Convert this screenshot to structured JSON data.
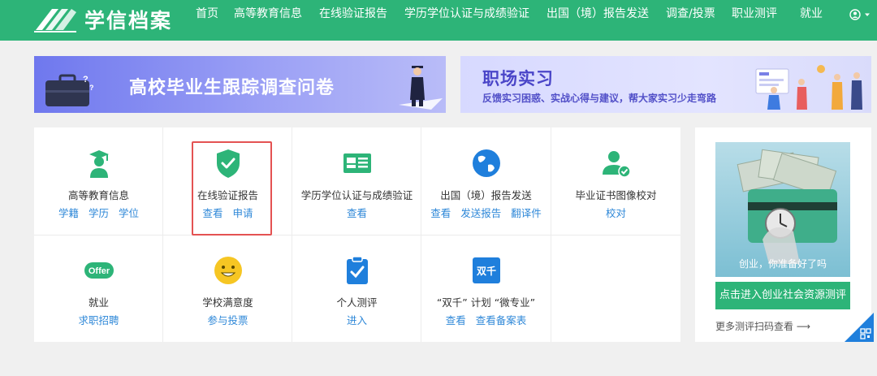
{
  "header": {
    "logo_text": "学信档案",
    "nav": [
      "首页",
      "高等教育信息",
      "在线验证报告",
      "学历学位认证与成绩验证",
      "出国（境）报告发送",
      "调查/投票",
      "职业测评",
      "就业"
    ],
    "brand_color": "#2db478"
  },
  "banners": {
    "left_title": "高校毕业生跟踪调查问卷",
    "right_title": "职场实习",
    "right_subtitle": "反馈实习困惑、实战心得与建议，帮大家实习少走弯路"
  },
  "services": [
    {
      "title": "高等教育信息",
      "links": [
        "学籍",
        "学历",
        "学位"
      ],
      "icon": "graduate-icon"
    },
    {
      "title": "在线验证报告",
      "links": [
        "查看",
        "申请"
      ],
      "icon": "shield-check-icon"
    },
    {
      "title": "学历学位认证与成绩验证",
      "links": [
        "查看"
      ],
      "icon": "id-card-icon"
    },
    {
      "title": "出国（境）报告发送",
      "links": [
        "查看",
        "发送报告",
        "翻译件"
      ],
      "icon": "globe-icon"
    },
    {
      "title": "毕业证书图像校对",
      "links": [
        "校对"
      ],
      "icon": "user-check-icon"
    },
    {
      "title": "就业",
      "links": [
        "求职招聘"
      ],
      "icon": "offer-icon",
      "icon_text": "Offer"
    },
    {
      "title": "学校满意度",
      "links": [
        "参与投票"
      ],
      "icon": "smiley-icon"
    },
    {
      "title": "个人测评",
      "links": [
        "进入"
      ],
      "icon": "clipboard-check-icon"
    },
    {
      "title": "“双千” 计划 “微专业”",
      "links": [
        "查看",
        "查看备案表"
      ],
      "icon": "shuangqian-icon",
      "icon_text": "双千"
    }
  ],
  "side_ad": {
    "image_caption": "创业，你准备好了吗",
    "button_label": "点击进入创业社会资源测评",
    "more_label": "更多测评扫码查看 ⟶"
  },
  "colors": {
    "accent": "#2db478",
    "link": "#2f88d8",
    "highlight": "#e45252"
  }
}
